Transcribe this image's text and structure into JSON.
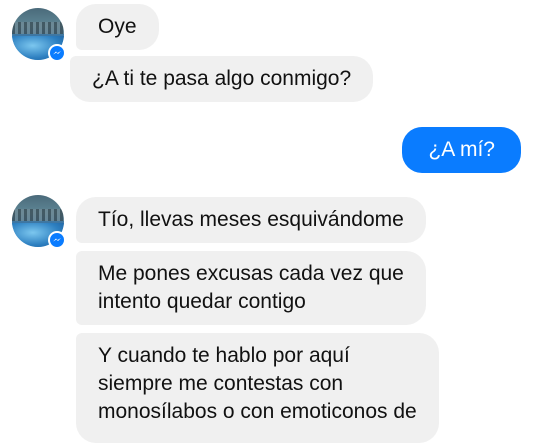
{
  "conversation": {
    "incoming_group_1": [
      "Oye",
      "¿A ti te pasa algo conmigo?"
    ],
    "outgoing": [
      "¿A mí?"
    ],
    "incoming_group_2": [
      "Tío, llevas meses esquivándome",
      "Me pones excusas cada vez que\nintento quedar contigo",
      "Y cuando te hablo por aquí\nsiempre me contestas con\nmonosílabos o con emoticonos de"
    ]
  },
  "colors": {
    "incoming_bubble": "#f0f0f0",
    "outgoing_bubble": "#0a7cff",
    "messenger_badge": "#0a7cff"
  },
  "icons": {
    "avatar_badge": "messenger-icon"
  }
}
